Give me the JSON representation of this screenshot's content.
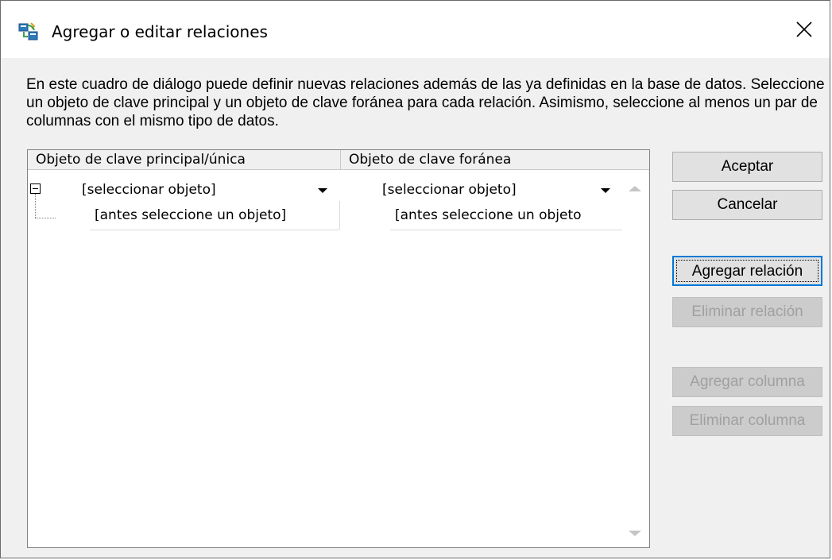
{
  "window": {
    "title": "Agregar o editar relaciones",
    "icon": "relations-icon",
    "close_icon": "close-icon"
  },
  "description": "En este cuadro de diálogo puede definir nuevas relaciones además de las ya definidas en la base de datos. Seleccione un objeto de clave principal y un objeto de clave foránea para cada relación. Asimismo, seleccione al menos un par de columnas con el mismo tipo de datos.",
  "grid": {
    "columns": [
      "Objeto de clave principal/única",
      "Objeto de clave foránea"
    ],
    "rows": [
      {
        "primary": "[seleccionar objeto]",
        "foreign": "[seleccionar objeto]",
        "children": [
          {
            "primary": "[antes seleccione un objeto]",
            "foreign": "[antes seleccione un objeto"
          }
        ]
      }
    ]
  },
  "buttons": {
    "ok": "Aceptar",
    "cancel": "Cancelar",
    "add_relation": "Agregar relación",
    "remove_relation": "Eliminar relación",
    "add_column": "Agregar columna",
    "remove_column": "Eliminar columna"
  },
  "colors": {
    "accent": "#0078d7",
    "disabled_text": "#a0a0a0"
  }
}
